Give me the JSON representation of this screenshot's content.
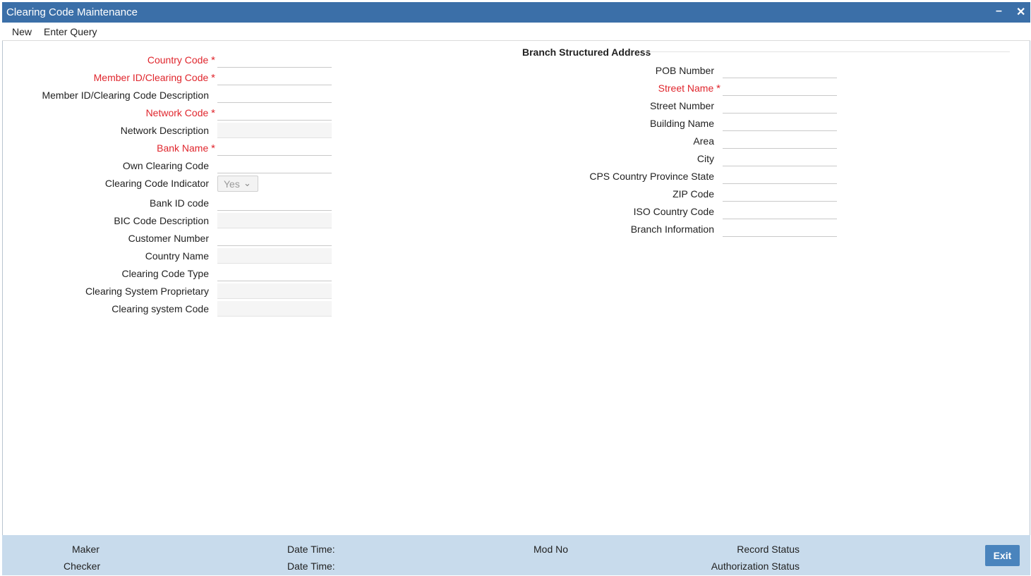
{
  "window": {
    "title": "Clearing Code Maintenance"
  },
  "menu": {
    "new": "New",
    "enter_query": "Enter Query"
  },
  "left_fields": [
    {
      "label": "Country Code",
      "required": true,
      "value": ""
    },
    {
      "label": "Member ID/Clearing Code",
      "required": true,
      "value": ""
    },
    {
      "label": "Member ID/Clearing Code Description",
      "required": false,
      "value": ""
    },
    {
      "label": "Network Code",
      "required": true,
      "value": ""
    },
    {
      "label": "Network Description",
      "required": false,
      "value": ""
    },
    {
      "label": "Bank Name",
      "required": true,
      "value": ""
    },
    {
      "label": "Own Clearing Code",
      "required": false,
      "value": ""
    },
    {
      "label": "Clearing Code Indicator",
      "required": false,
      "value": "Yes"
    },
    {
      "label": "Bank ID code",
      "required": false,
      "value": ""
    },
    {
      "label": "BIC Code Description",
      "required": false,
      "value": ""
    },
    {
      "label": "Customer Number",
      "required": false,
      "value": ""
    },
    {
      "label": "Country Name",
      "required": false,
      "value": ""
    },
    {
      "label": "Clearing Code Type",
      "required": false,
      "value": ""
    },
    {
      "label": "Clearing System Proprietary",
      "required": false,
      "value": ""
    },
    {
      "label": "Clearing system Code",
      "required": false,
      "value": ""
    }
  ],
  "address": {
    "section_title": "Branch Structured Address",
    "fields": [
      {
        "label": "POB Number",
        "required": false,
        "value": ""
      },
      {
        "label": "Street Name",
        "required": true,
        "value": ""
      },
      {
        "label": "Street Number",
        "required": false,
        "value": ""
      },
      {
        "label": "Building Name",
        "required": false,
        "value": ""
      },
      {
        "label": "Area",
        "required": false,
        "value": ""
      },
      {
        "label": "City",
        "required": false,
        "value": ""
      },
      {
        "label": "CPS Country Province State",
        "required": false,
        "value": ""
      },
      {
        "label": "ZIP Code",
        "required": false,
        "value": ""
      },
      {
        "label": "ISO Country Code",
        "required": false,
        "value": ""
      },
      {
        "label": "Branch Information",
        "required": false,
        "value": ""
      }
    ]
  },
  "footer": {
    "maker": "Maker",
    "checker": "Checker",
    "date_time_1": "Date Time:",
    "date_time_2": "Date Time:",
    "mod_no": "Mod No",
    "record_status": "Record Status",
    "authorization_status": "Authorization Status",
    "exit": "Exit"
  },
  "colors": {
    "title_bar": "#3b6fa8",
    "required": "#e0262d",
    "footer": "#c8dbec",
    "exit_button": "#4a84bd"
  },
  "icons": {
    "minimize": "minimize-icon",
    "close": "close-icon",
    "dropdown": "chevron-down-icon"
  }
}
